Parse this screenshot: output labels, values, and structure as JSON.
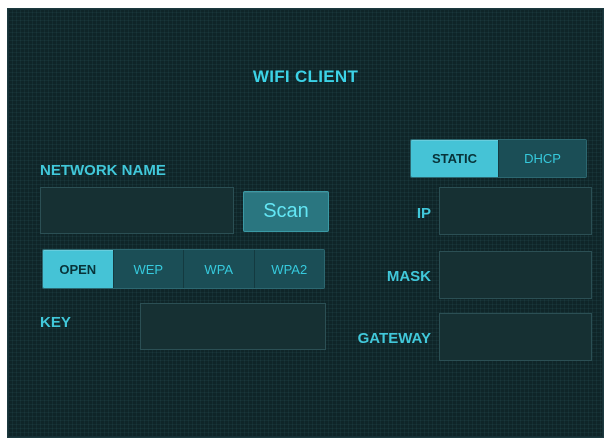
{
  "title": "WIFI CLIENT",
  "network": {
    "label": "NETWORK NAME",
    "value": "",
    "scan_label": "Scan"
  },
  "security": {
    "options": [
      "OPEN",
      "WEP",
      "WPA",
      "WPA2"
    ],
    "selected": "OPEN"
  },
  "key": {
    "label": "KEY",
    "value": ""
  },
  "addressing": {
    "options": [
      "STATIC",
      "DHCP"
    ],
    "selected": "STATIC"
  },
  "ip": {
    "label": "IP",
    "value": ""
  },
  "mask": {
    "label": "MASK",
    "value": ""
  },
  "gateway": {
    "label": "GATEWAY",
    "value": ""
  },
  "colors": {
    "background": "#0f2528",
    "accent": "#3cd2e6",
    "active_segment": "#45c3d6",
    "button": "#2a7680"
  }
}
